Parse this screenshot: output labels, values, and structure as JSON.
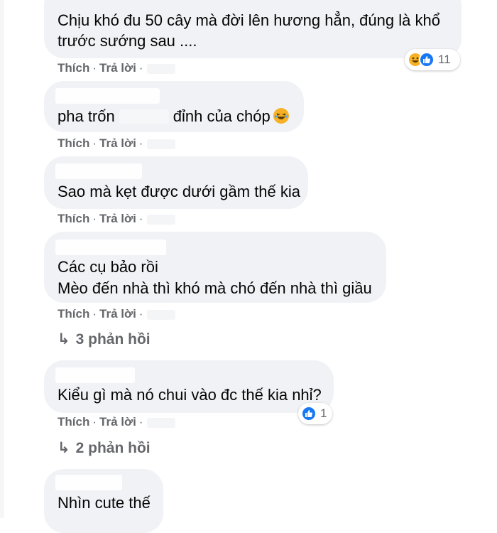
{
  "actions": {
    "like": "Thích",
    "reply": "Trả lời",
    "dot": "·"
  },
  "comments": [
    {
      "lines": [
        "Chịu khó đu 50 cây mà đời lên hương hẳn, đúng là khổ",
        "trước sướng sau ...."
      ],
      "reaction_count": "11",
      "reaction_icons": [
        "haha-icon",
        "like-icon"
      ]
    },
    {
      "text_before": "pha trốn",
      "text_after": "đỉnh của chóp",
      "trailing_emoji": "haha-emoji-icon"
    },
    {
      "lines": [
        "Sao mà kẹt được dưới gầm thế kia"
      ]
    },
    {
      "lines": [
        "Các cụ bảo rồi",
        "Mèo đến nhà thì khó mà chó đến nhà thì giầu"
      ],
      "replies_label": "3 phản hồi"
    },
    {
      "lines": [
        "Kiểu gì mà nó chui vào đc thế kia nhỉ?"
      ],
      "reaction_count": "1",
      "reaction_icons": [
        "like-icon"
      ],
      "replies_label": "2 phản hồi"
    },
    {
      "lines": [
        "Nhìn cute thế"
      ]
    }
  ],
  "colors": {
    "bubble": "#f0f2f5",
    "meta_text": "#65676b",
    "like_blue": "#1877f2",
    "haha_yellow": "#f7b125"
  }
}
